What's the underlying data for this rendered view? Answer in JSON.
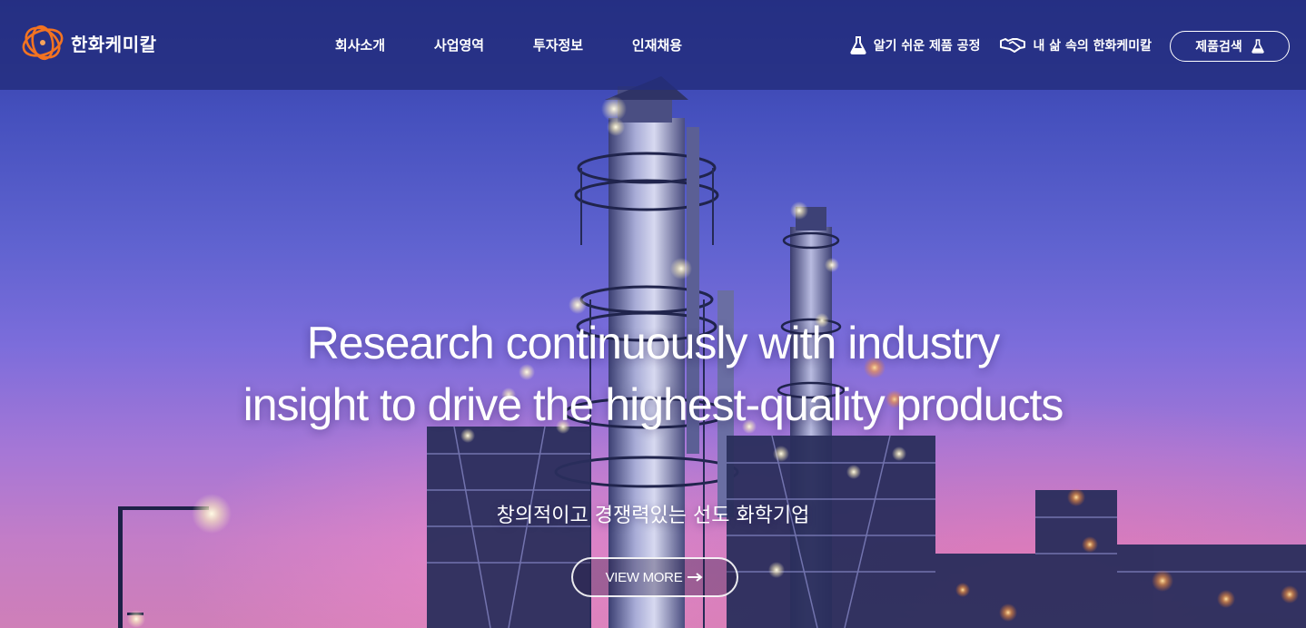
{
  "brand": {
    "name": "한화케미칼",
    "logo_icon": "hanwha-logo-icon"
  },
  "nav": {
    "items": [
      {
        "label": "회사소개"
      },
      {
        "label": "사업영역"
      },
      {
        "label": "투자정보"
      },
      {
        "label": "인재채용"
      }
    ]
  },
  "utility": {
    "process_link": {
      "label": "알기 쉬운 제품 공정",
      "icon": "flask-icon"
    },
    "life_link": {
      "label": "내 삶 속의 한화케미칼",
      "icon": "handshake-icon"
    },
    "search_button": {
      "label": "제품검색",
      "icon": "flask-icon"
    }
  },
  "hero": {
    "headline_line1": "Research continuously with industry",
    "headline_line2": "insight to drive the highest-quality products",
    "subheadline": "창의적이고 경쟁력있는 선도 화학기업",
    "cta_label": "VIEW MORE",
    "cta_icon": "arrow-right-icon"
  },
  "colors": {
    "header_bg": "#232d7d",
    "sky_top": "#2f3aa3",
    "sky_bottom": "#cf7fb8",
    "logo_orange": "#f37321"
  }
}
